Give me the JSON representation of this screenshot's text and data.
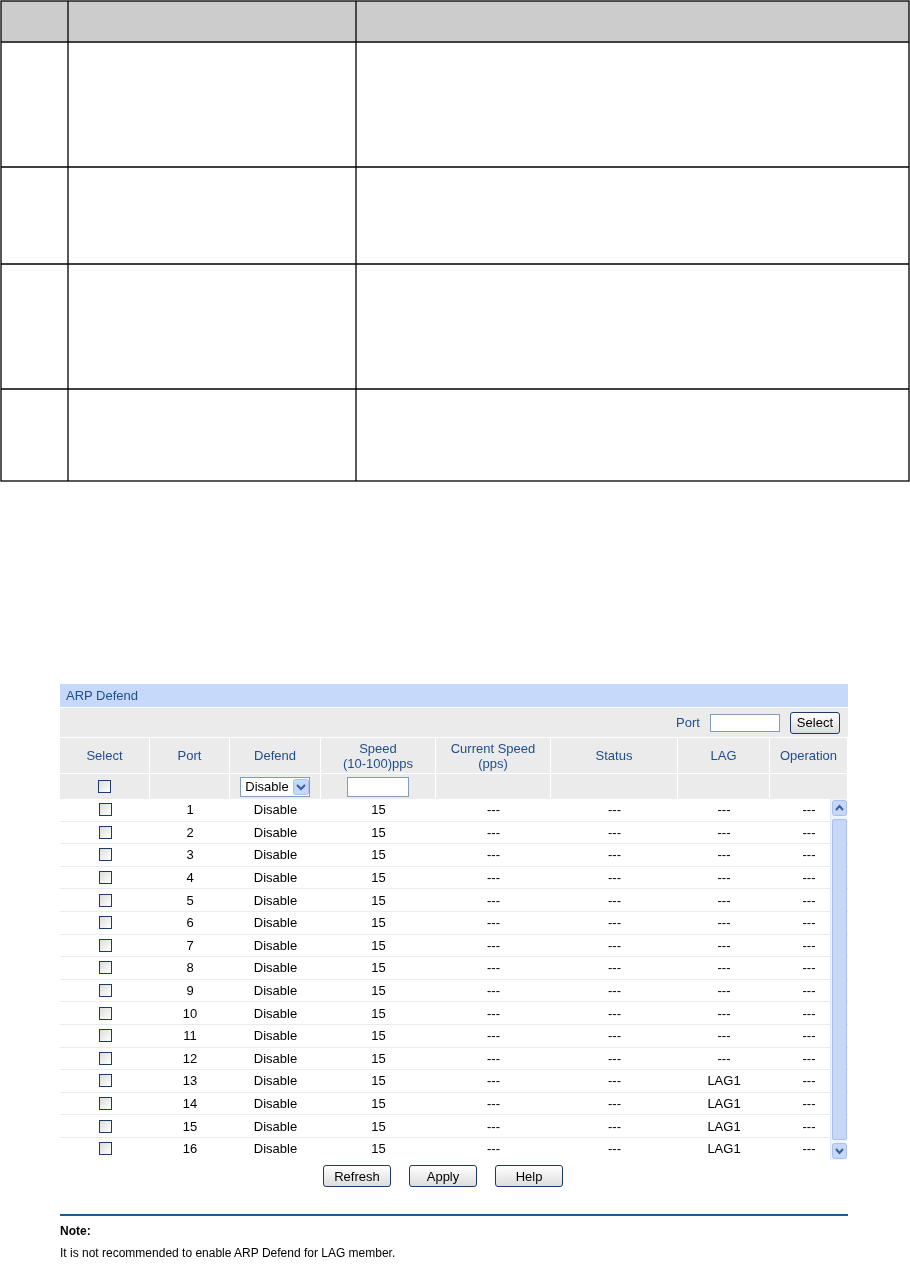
{
  "panel": {
    "title": "ARP Defend",
    "port_label": "Port",
    "select_button": "Select",
    "columns": [
      "Select",
      "Port",
      "Defend",
      "Speed\n(10-100)pps",
      "Current Speed\n(pps)",
      "Status",
      "LAG",
      "Operation"
    ],
    "filter": {
      "checked": false,
      "defend": "Disable"
    },
    "rows": [
      {
        "checked": false,
        "port": "1",
        "defend": "Disable",
        "speed": "15",
        "current_speed": "---",
        "status": "---",
        "lag": "---",
        "operation": "---"
      },
      {
        "checked": false,
        "port": "2",
        "defend": "Disable",
        "speed": "15",
        "current_speed": "---",
        "status": "---",
        "lag": "---",
        "operation": "---"
      },
      {
        "checked": false,
        "port": "3",
        "defend": "Disable",
        "speed": "15",
        "current_speed": "---",
        "status": "---",
        "lag": "---",
        "operation": "---"
      },
      {
        "checked": false,
        "port": "4",
        "defend": "Disable",
        "speed": "15",
        "current_speed": "---",
        "status": "---",
        "lag": "---",
        "operation": "---"
      },
      {
        "checked": false,
        "port": "5",
        "defend": "Disable",
        "speed": "15",
        "current_speed": "---",
        "status": "---",
        "lag": "---",
        "operation": "---"
      },
      {
        "checked": false,
        "port": "6",
        "defend": "Disable",
        "speed": "15",
        "current_speed": "---",
        "status": "---",
        "lag": "---",
        "operation": "---"
      },
      {
        "checked": false,
        "port": "7",
        "defend": "Disable",
        "speed": "15",
        "current_speed": "---",
        "status": "---",
        "lag": "---",
        "operation": "---"
      },
      {
        "checked": false,
        "port": "8",
        "defend": "Disable",
        "speed": "15",
        "current_speed": "---",
        "status": "---",
        "lag": "---",
        "operation": "---"
      },
      {
        "checked": false,
        "port": "9",
        "defend": "Disable",
        "speed": "15",
        "current_speed": "---",
        "status": "---",
        "lag": "---",
        "operation": "---"
      },
      {
        "checked": false,
        "port": "10",
        "defend": "Disable",
        "speed": "15",
        "current_speed": "---",
        "status": "---",
        "lag": "---",
        "operation": "---"
      },
      {
        "checked": false,
        "port": "11",
        "defend": "Disable",
        "speed": "15",
        "current_speed": "---",
        "status": "---",
        "lag": "---",
        "operation": "---"
      },
      {
        "checked": false,
        "port": "12",
        "defend": "Disable",
        "speed": "15",
        "current_speed": "---",
        "status": "---",
        "lag": "---",
        "operation": "---"
      },
      {
        "checked": false,
        "port": "13",
        "defend": "Disable",
        "speed": "15",
        "current_speed": "---",
        "status": "---",
        "lag": "LAG1",
        "operation": "---"
      },
      {
        "checked": false,
        "port": "14",
        "defend": "Disable",
        "speed": "15",
        "current_speed": "---",
        "status": "---",
        "lag": "LAG1",
        "operation": "---"
      },
      {
        "checked": false,
        "port": "15",
        "defend": "Disable",
        "speed": "15",
        "current_speed": "---",
        "status": "---",
        "lag": "LAG1",
        "operation": "---"
      },
      {
        "checked": false,
        "port": "16",
        "defend": "Disable",
        "speed": "15",
        "current_speed": "---",
        "status": "---",
        "lag": "LAG1",
        "operation": "---"
      }
    ],
    "buttons": [
      "Refresh",
      "Apply",
      "Help"
    ],
    "note": {
      "title": "Note:",
      "text": "It is not recommended to enable ARP Defend for LAG member."
    }
  }
}
